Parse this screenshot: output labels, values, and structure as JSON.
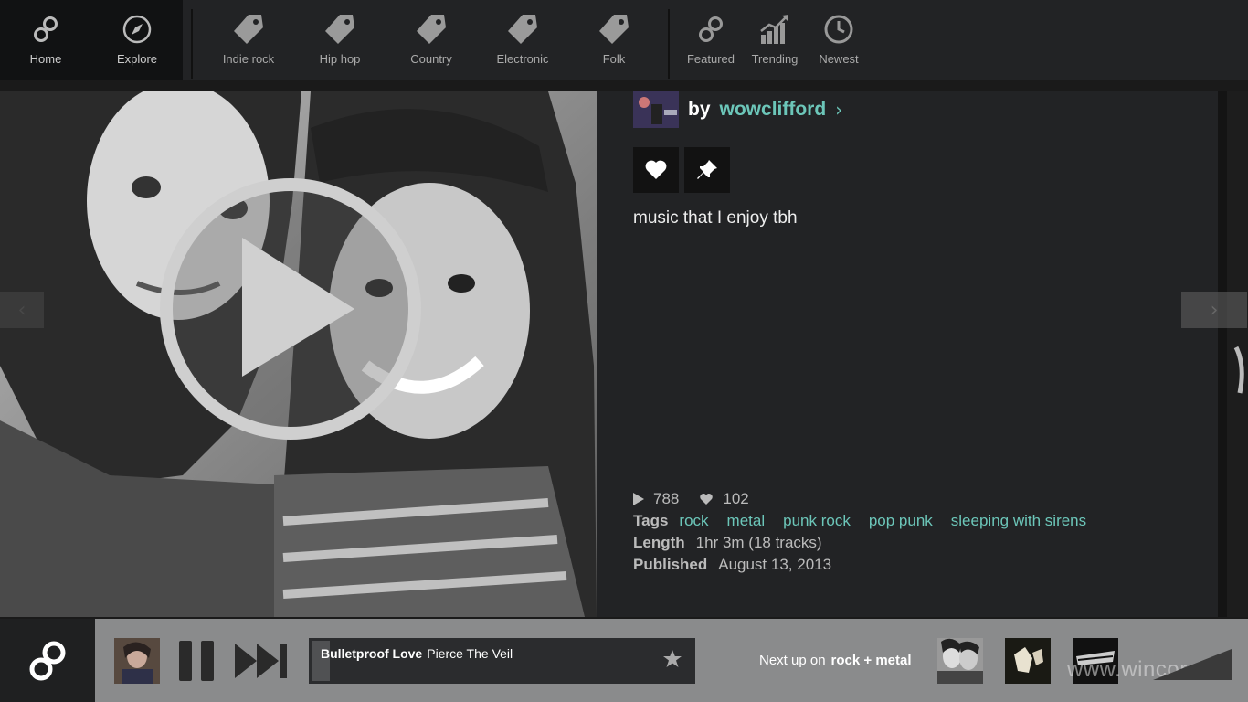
{
  "nav": {
    "left": [
      {
        "label": "Home",
        "icon": "infinity-icon"
      },
      {
        "label": "Explore",
        "icon": "compass-icon"
      }
    ],
    "genres": [
      {
        "label": "Indie rock",
        "icon": "tag-icon"
      },
      {
        "label": "Hip hop",
        "icon": "tag-icon"
      },
      {
        "label": "Country",
        "icon": "tag-icon"
      },
      {
        "label": "Electronic",
        "icon": "tag-icon"
      },
      {
        "label": "Folk",
        "icon": "tag-icon"
      }
    ],
    "right": [
      {
        "label": "Featured",
        "icon": "infinity-icon"
      },
      {
        "label": "Trending",
        "icon": "trending-chart-icon"
      },
      {
        "label": "Newest",
        "icon": "clock-icon"
      }
    ]
  },
  "mix": {
    "by_label": "by",
    "author": "wowclifford",
    "author_chevron": "›",
    "description": "music that I enjoy tbh",
    "plays": "788",
    "likes": "102",
    "tags_label": "Tags",
    "tags": [
      "rock",
      "metal",
      "punk rock",
      "pop punk",
      "sleeping with sirens"
    ],
    "length_label": "Length",
    "length": "1hr 3m (18 tracks)",
    "published_label": "Published",
    "published": "August 13, 2013"
  },
  "player": {
    "track_title": "Bulletproof Love",
    "track_artist": "Pierce The Veil",
    "progress": 0.03,
    "next_up_label": "Next up on",
    "next_up_tags": "rock + metal",
    "watermark": "www.wincore.ru"
  },
  "colors": {
    "accent": "#6cc6b9",
    "topbar": "#222325",
    "player_bg": "#8a8b8c"
  }
}
